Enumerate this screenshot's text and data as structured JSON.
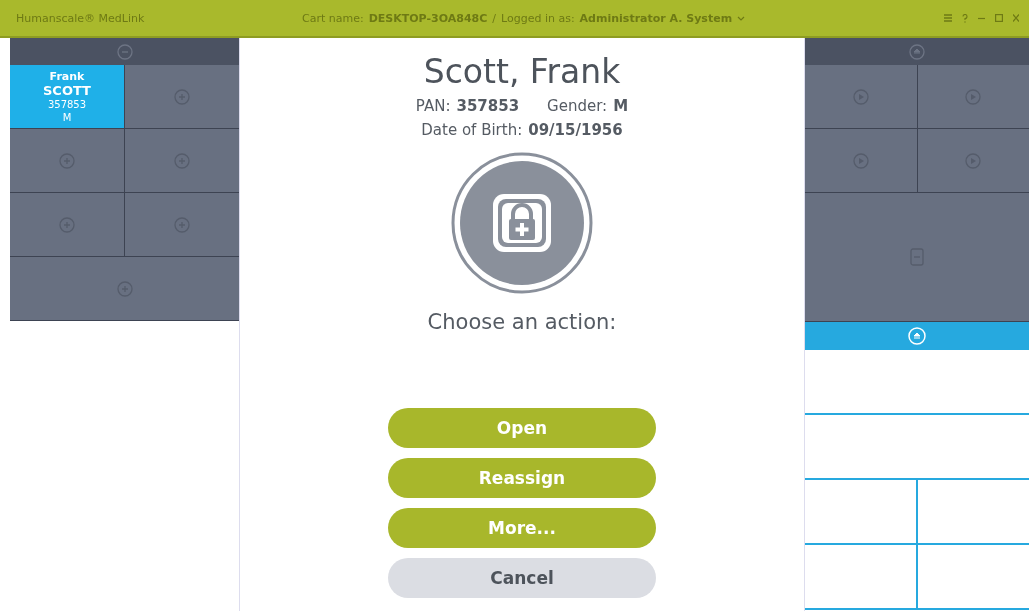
{
  "title_bar": {
    "app_name": "Humanscale® MedLink",
    "cart_label": "Cart name:",
    "cart_name": "DESKTOP-3OA848C",
    "separator": "/",
    "user_label": "Logged in as:",
    "user_name": "Administrator A. System"
  },
  "left_cabinet": {
    "drawers": [
      {
        "kind": "patient",
        "wide": false,
        "selected": true,
        "first_name": "Frank",
        "last_name": "SCOTT",
        "pan": "357853",
        "gender": "M"
      },
      {
        "kind": "empty",
        "wide": false,
        "selected": false
      },
      {
        "kind": "empty",
        "wide": false,
        "selected": false
      },
      {
        "kind": "empty",
        "wide": false,
        "selected": false
      },
      {
        "kind": "empty",
        "wide": false,
        "selected": false
      },
      {
        "kind": "empty",
        "wide": false,
        "selected": false
      },
      {
        "kind": "empty",
        "wide": true,
        "selected": false
      }
    ]
  },
  "patient": {
    "name": "Scott, Frank",
    "pan_label": "PAN:",
    "pan": "357853",
    "gender_label": "Gender:",
    "gender": "M",
    "dob_label": "Date of Birth:",
    "dob": "09/15/1956",
    "prompt": "Choose an action:",
    "actions": [
      {
        "label": "Open",
        "kind": "primary"
      },
      {
        "label": "Reassign",
        "kind": "primary"
      },
      {
        "label": "More...",
        "kind": "primary"
      },
      {
        "label": "Cancel",
        "kind": "secondary"
      }
    ]
  },
  "right_cabinet": {
    "sections": [
      {
        "kind": "dark",
        "drawers": [
          {
            "kind": "play",
            "wide": false
          },
          {
            "kind": "play",
            "wide": false
          },
          {
            "kind": "play",
            "wide": false
          },
          {
            "kind": "play",
            "wide": false
          },
          {
            "kind": "box",
            "wide": true
          }
        ]
      },
      {
        "kind": "blue",
        "drawers": [
          {
            "kind": "blank",
            "wide": true
          },
          {
            "kind": "blank",
            "wide": true
          },
          {
            "kind": "blank",
            "wide": false
          },
          {
            "kind": "blank",
            "wide": false
          },
          {
            "kind": "blank",
            "wide": false
          },
          {
            "kind": "blank",
            "wide": false
          }
        ]
      }
    ]
  }
}
